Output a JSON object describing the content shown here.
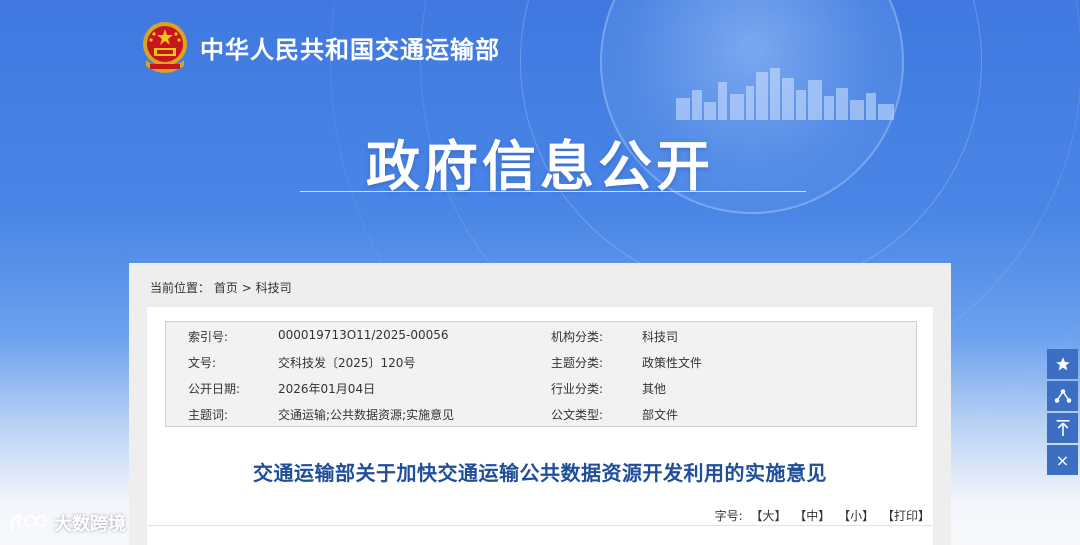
{
  "header": {
    "ministry_name": "中华人民共和国交通运输部",
    "section_title": "政府信息公开"
  },
  "breadcrumb": {
    "prefix": "当前位置：",
    "home": "首页",
    "separator": ">",
    "current": "科技司"
  },
  "meta": {
    "rows": [
      {
        "label1": "索引号:",
        "value1": "000019713O11/2025-00056",
        "label2": "机构分类:",
        "value2": "科技司"
      },
      {
        "label1": "文号:",
        "value1": "交科技发〔2025〕120号",
        "label2": "主题分类:",
        "value2": "政策性文件"
      },
      {
        "label1": "公开日期:",
        "value1": "2026年01月04日",
        "label2": "行业分类:",
        "value2": "其他"
      },
      {
        "label1": "主题词:",
        "value1": "交通运输;公共数据资源;实施意见",
        "label2": "公文类型:",
        "value2": "部文件"
      }
    ]
  },
  "document": {
    "title": "交通运输部关于加快交通运输公共数据资源开发利用的实施意见"
  },
  "font_size_tools": {
    "label": "字号:",
    "large": "【大】",
    "medium": "【中】",
    "small": "【小】",
    "print": "【打印】"
  },
  "side_tools": {
    "icons": [
      "star-icon",
      "share-icon",
      "back-to-top-icon",
      "close-icon"
    ],
    "close_glyph": "×"
  },
  "watermark": {
    "text": "大数跨境"
  },
  "colors": {
    "hero_blue": "#3f79e0",
    "doc_title": "#1f4e9a",
    "side_tool_bg": "#3c6fc4"
  }
}
